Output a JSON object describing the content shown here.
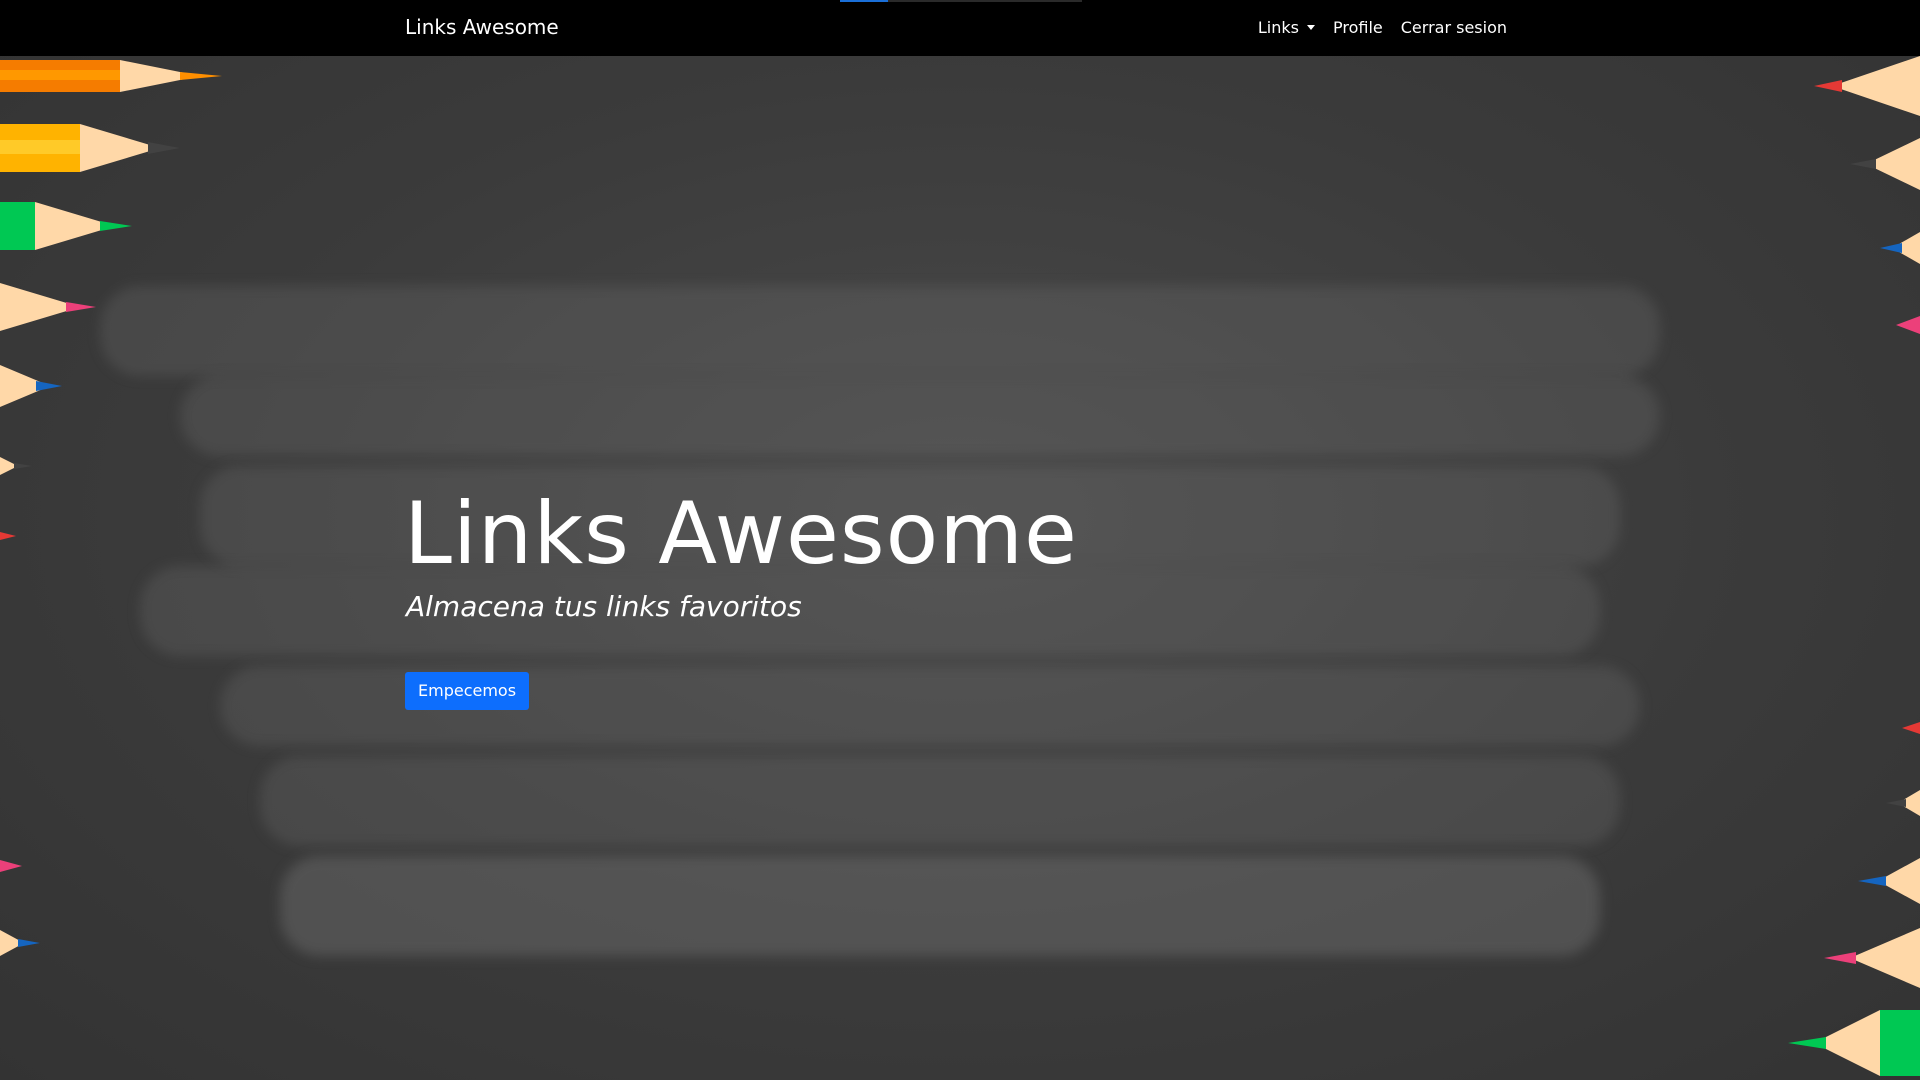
{
  "navbar": {
    "brand": "Links Awesome",
    "links_label": "Links",
    "profile_label": "Profile",
    "logout_label": "Cerrar sesion",
    "loading_progress": 0.2
  },
  "hero": {
    "title": "Links Awesome",
    "subtitle": "Almacena tus links favoritos",
    "cta_label": "Empecemos"
  },
  "colors": {
    "navbar_bg": "#000000",
    "board_bg": "#3d3d3d",
    "cta_bg": "#0d6efd"
  }
}
